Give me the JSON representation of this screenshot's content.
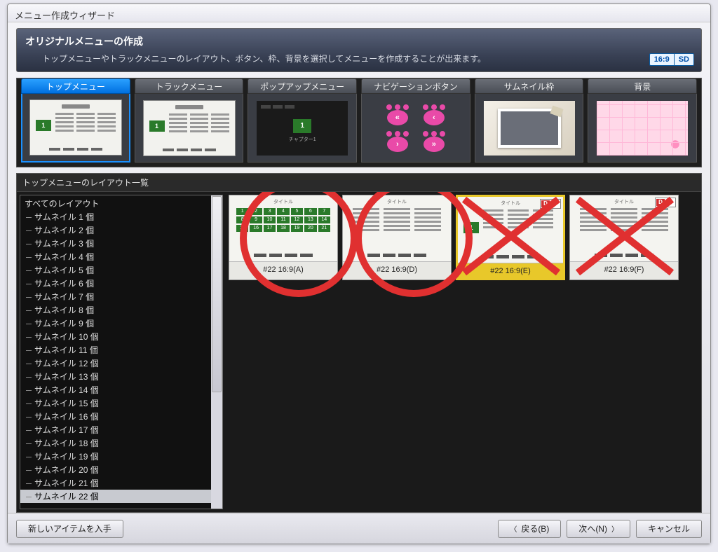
{
  "window_title": "メニュー作成ウィザード",
  "header": {
    "heading": "オリジナルメニューの作成",
    "desc": "トップメニューやトラックメニューのレイアウト、ボタン、枠、背景を選択してメニューを作成することが出来ます。",
    "badge_aspect": "16:9",
    "badge_def": "SD"
  },
  "categories": [
    {
      "label": "トップメニュー",
      "active": true
    },
    {
      "label": "トラックメニュー",
      "active": false
    },
    {
      "label": "ポップアップメニュー",
      "active": false
    },
    {
      "label": "ナビゲーションボタン",
      "active": false
    },
    {
      "label": "サムネイル枠",
      "active": false
    },
    {
      "label": "背景",
      "active": false
    }
  ],
  "list_title": "トップメニューのレイアウト一覧",
  "tree": {
    "root": "すべてのレイアウト",
    "items": [
      "サムネイル 1 個",
      "サムネイル 2 個",
      "サムネイル 3 個",
      "サムネイル 4 個",
      "サムネイル 5 個",
      "サムネイル 6 個",
      "サムネイル 7 個",
      "サムネイル 8 個",
      "サムネイル 9 個",
      "サムネイル 10 個",
      "サムネイル 11 個",
      "サムネイル 12 個",
      "サムネイル 13 個",
      "サムネイル 14 個",
      "サムネイル 15 個",
      "サムネイル 16 個",
      "サムネイル 17 個",
      "サムネイル 18 個",
      "サムネイル 19 個",
      "サムネイル 20 個",
      "サムネイル 21 個",
      "サムネイル 22 個"
    ],
    "selected_index": 21
  },
  "previews": [
    {
      "label": "#22 16:9(A)",
      "selected": false,
      "badge": false
    },
    {
      "label": "#22 16:9(D)",
      "selected": false,
      "badge": false
    },
    {
      "label": "#22 16:9(E)",
      "selected": true,
      "badge": true
    },
    {
      "label": "#22 16:9(F)",
      "selected": false,
      "badge": true
    }
  ],
  "thumb_title": "タイトル",
  "popup_caption": "チャプター1",
  "footer": {
    "get_items": "新しいアイテムを入手",
    "back": "戻る(B)",
    "next": "次へ(N)",
    "cancel": "キャンセル"
  }
}
